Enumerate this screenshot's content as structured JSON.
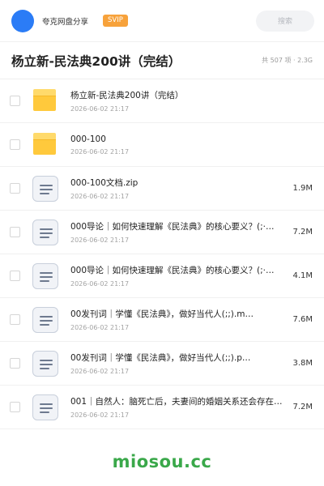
{
  "topbar": {
    "brand": "夸克网盘分享",
    "badge": "SVIP",
    "search_placeholder": "搜索",
    "accent": "#2b7cf6",
    "badge_color": "#f7a23b"
  },
  "header": {
    "title": "杨立新-民法典200讲（完结）",
    "meta": "共 507 项 · 2.3G"
  },
  "files": [
    {
      "type": "folder",
      "icon": "folder-icon",
      "name": "杨立新-民法典200讲（完结）",
      "date": "2026-06-02 21:17",
      "size": ""
    },
    {
      "type": "folder",
      "icon": "folder-icon",
      "name": "000-100",
      "date": "2026-06-02 21:17",
      "size": ""
    },
    {
      "type": "file",
      "icon": "document-icon",
      "name": "000-100文档.zip",
      "date": "2026-06-02 21:17",
      "size": "1.9M"
    },
    {
      "type": "file",
      "icon": "document-icon",
      "name": "000导论｜如何快速理解《民法典》的核心要义？(;·…",
      "date": "2026-06-02 21:17",
      "size": "7.2M"
    },
    {
      "type": "file",
      "icon": "document-icon",
      "name": "000导论｜如何快速理解《民法典》的核心要义？(;·…",
      "date": "2026-06-02 21:17",
      "size": "4.1M"
    },
    {
      "type": "file",
      "icon": "document-icon",
      "name": "00发刊词｜学懂《民法典》，做好当代人(;;).m…",
      "date": "2026-06-02 21:17",
      "size": "7.6M"
    },
    {
      "type": "file",
      "icon": "document-icon",
      "name": "00发刊词｜学懂《民法典》，做好当代人(;;).p…",
      "date": "2026-06-02 21:17",
      "size": "3.8M"
    },
    {
      "type": "file",
      "icon": "document-icon",
      "name": "001｜自然人：脑死亡后，夫妻间的婚姻关系还会存在…",
      "date": "2026-06-02 21:17",
      "size": "7.2M"
    }
  ],
  "footer": {
    "watermark": "miosou.cc",
    "watermark_color": "#3aa84a"
  }
}
